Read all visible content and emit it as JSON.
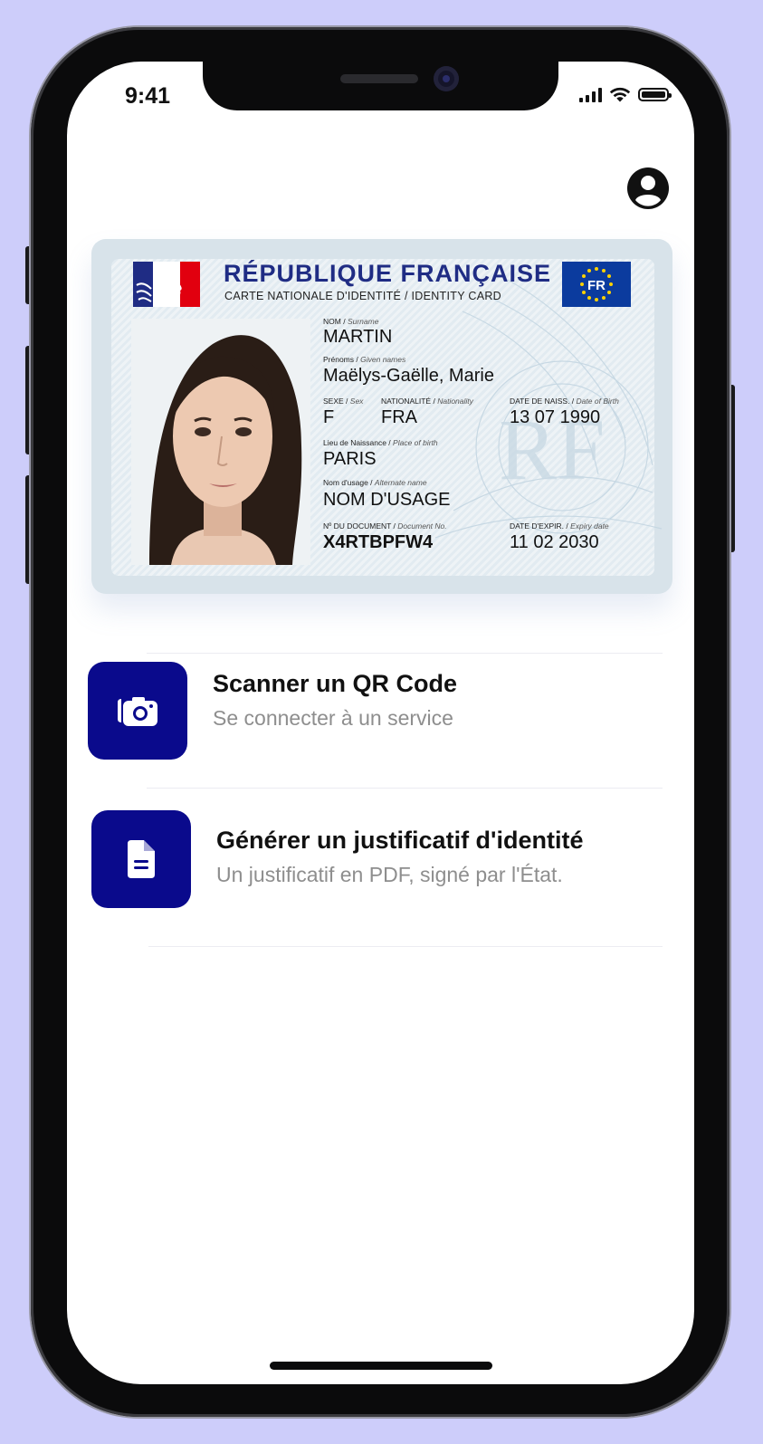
{
  "status_bar": {
    "time": "9:41"
  },
  "header": {
    "profile_icon": "account-circle-icon"
  },
  "id_card": {
    "title": "RÉPUBLIQUE FRANÇAISE",
    "subtitle": "CARTE NATIONALE D'IDENTITÉ / IDENTITY CARD",
    "country_code": "FR",
    "surname_label": "NOM /",
    "surname_label_en": "Surname",
    "surname": "MARTIN",
    "given_names_label": "Prénoms /",
    "given_names_label_en": "Given names",
    "given_names": "Maëlys-Gaëlle, Marie",
    "sex_label": "SEXE /",
    "sex_label_en": "Sex",
    "sex": "F",
    "nationality_label": "NATIONALITÉ /",
    "nationality_label_en": "Nationality",
    "nationality": "FRA",
    "birth_date_label": "DATE DE NAISS. /",
    "birth_date_label_en": "Date of Birth",
    "birth_date": "13 07 1990",
    "birth_place_label": "Lieu de Naissance /",
    "birth_place_label_en": "Place of birth",
    "birth_place": "PARIS",
    "usage_name_label": "Nom d'usage /",
    "usage_name_label_en": "Alternate name",
    "usage_name": "NOM D'USAGE",
    "document_no_label": "Nº DU DOCUMENT /",
    "document_no_label_en": "Document No.",
    "document_no": "X4RTBPFW4",
    "expiry_label": "DATE D'EXPIR. /",
    "expiry_label_en": "Expiry date",
    "expiry_date": "11 02 2030"
  },
  "actions": [
    {
      "title": "Scanner un QR Code",
      "subtitle": "Se connecter à un service",
      "icon": "camera-icon"
    },
    {
      "title": "Générer un justificatif d'identité",
      "subtitle": "Un justificatif en PDF, signé par l'État.",
      "icon": "document-icon"
    }
  ],
  "colors": {
    "background": "#cdcdfa",
    "accent": "#0a0a8c",
    "card_title": "#1f2c84"
  }
}
